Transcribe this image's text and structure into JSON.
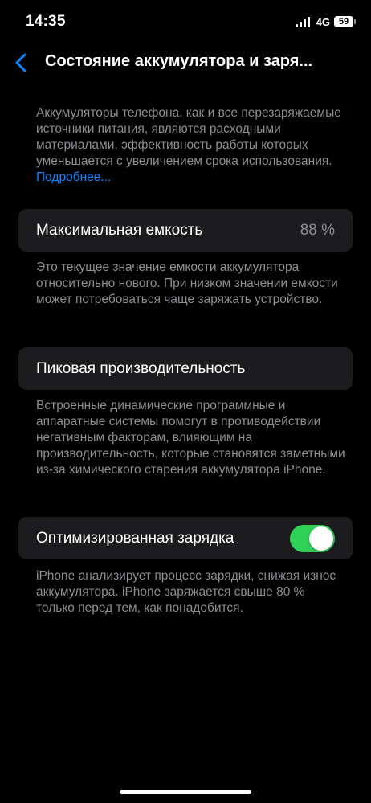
{
  "status_bar": {
    "time": "14:35",
    "network": "4G",
    "battery_level": "59"
  },
  "nav": {
    "back_icon": "chevron-left-icon",
    "title": "Состояние аккумулятора и заря..."
  },
  "intro": {
    "text": "Аккумуляторы телефона, как и все переза­ряжаемые источники питания, являются расходными материалами, эффективность работы которых уменьшается с увеличе­нием срока использования. ",
    "link_label": "Подробнее..."
  },
  "max_capacity": {
    "label": "Максимальная емкость",
    "value": "88 %",
    "description": "Это текущее значение емкости аккумуля­тора относительно нового. При низком значении емкости может потребоваться чаще заряжать устройство."
  },
  "peak_performance": {
    "label": "Пиковая производительность",
    "description": "Встроенные динамические программные и аппаратные системы помогут в про­тиводействии негативным факторам, влияющим на производительность, которые становятся заметными из-за химического старения аккумулятора iPhone."
  },
  "optimized_charging": {
    "label": "Оптимизированная зарядка",
    "enabled": true,
    "description": "iPhone анализирует процесс зарядки, снижая износ аккумулятора. iPhone заряжается свыше 80 % только перед тем, как понадобится."
  },
  "colors": {
    "background": "#000000",
    "cell_background": "#1c1c1e",
    "secondary_text": "#8e8e93",
    "link": "#0a84ff",
    "toggle_on": "#30d158"
  }
}
